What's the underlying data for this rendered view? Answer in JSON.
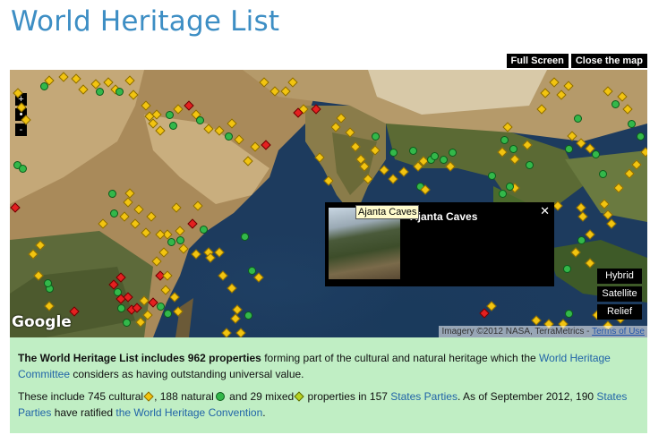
{
  "title": "World Heritage List",
  "map_controls": {
    "full_screen": "Full Screen",
    "close_map": "Close the map",
    "zoom_in": "+",
    "zoom_mid": "•",
    "zoom_out": "-",
    "layers": [
      "Hybrid",
      "Satellite",
      "Relief"
    ],
    "google": "Google",
    "attribution": "Imagery ©2012 NASA, TerraMetrics -",
    "terms": "Terms of Use"
  },
  "popup": {
    "title": "Ajanta Caves",
    "tooltip": "Ajanta Caves",
    "close": "✕"
  },
  "colors": {
    "cultural": "#f2c410",
    "natural": "#33b84a",
    "mixed": "#b6d322",
    "danger": "#e42020",
    "info_bg": "#c0eec4",
    "title": "#3d8ec4"
  },
  "info": {
    "p1_pre": "The World Heritage List includes 962 properties",
    "p1_mid": " forming part of the cultural and natural heritage which the ",
    "p1_link": "World Heritage Committee",
    "p1_post": " considers as having outstanding universal value.",
    "p2_a": "These include 745 cultural",
    "p2_b": ", 188 natural",
    "p2_c": " and 29 mixed",
    "p2_d": " properties in 157 ",
    "p2_link1": "States Parties",
    "p2_e": ". As of September 2012, 190 ",
    "p2_link2": "States Parties",
    "p2_f": " have ratified ",
    "p2_link3": "the World Heritage Convention",
    "p2_g": "."
  }
}
